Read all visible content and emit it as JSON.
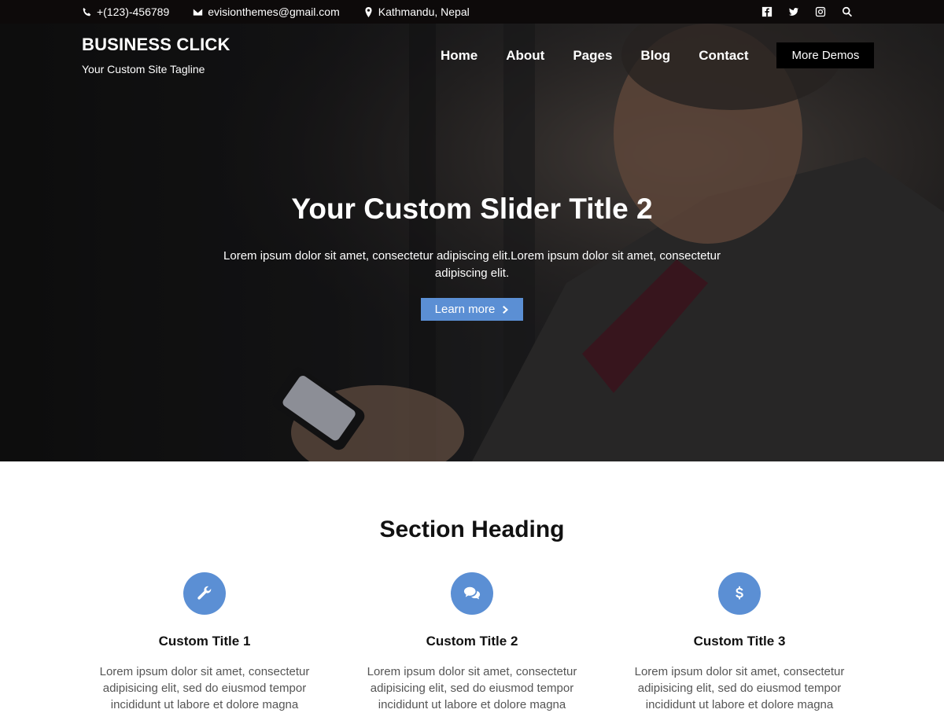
{
  "topbar": {
    "phone": "+(123)-456789",
    "email": "evisionthemes@gmail.com",
    "location": "Kathmandu, Nepal",
    "social_icons": [
      "facebook-icon",
      "twitter-icon",
      "instagram-icon",
      "search-icon"
    ]
  },
  "header": {
    "site_title": "BUSINESS CLICK",
    "tagline": "Your Custom Site Tagline",
    "nav": [
      "Home",
      "About",
      "Pages",
      "Blog",
      "Contact"
    ],
    "cta": "More Demos"
  },
  "slider": {
    "title": "Your Custom Slider Title 2",
    "text": "Lorem ipsum dolor sit amet, consectetur adipiscing elit.Lorem ipsum dolor sit amet, consectetur adipiscing elit.",
    "button": "Learn more"
  },
  "section": {
    "heading": "Section Heading",
    "features": [
      {
        "icon": "wrench-icon",
        "title": "Custom Title 1",
        "text": "Lorem ipsum dolor sit amet, consectetur adipisicing elit, sed do eiusmod tempor incididunt ut labore et dolore magna"
      },
      {
        "icon": "comments-icon",
        "title": "Custom Title 2",
        "text": "Lorem ipsum dolor sit amet, consectetur adipisicing elit, sed do eiusmod tempor incididunt ut labore et dolore magna"
      },
      {
        "icon": "dollar-icon",
        "title": "Custom Title 3",
        "text": "Lorem ipsum dolor sit amet, consectetur adipisicing elit, sed do eiusmod tempor incididunt ut labore et dolore magna"
      }
    ]
  },
  "colors": {
    "accent": "#5b8fd4",
    "topbar": "#0d0a0a"
  }
}
